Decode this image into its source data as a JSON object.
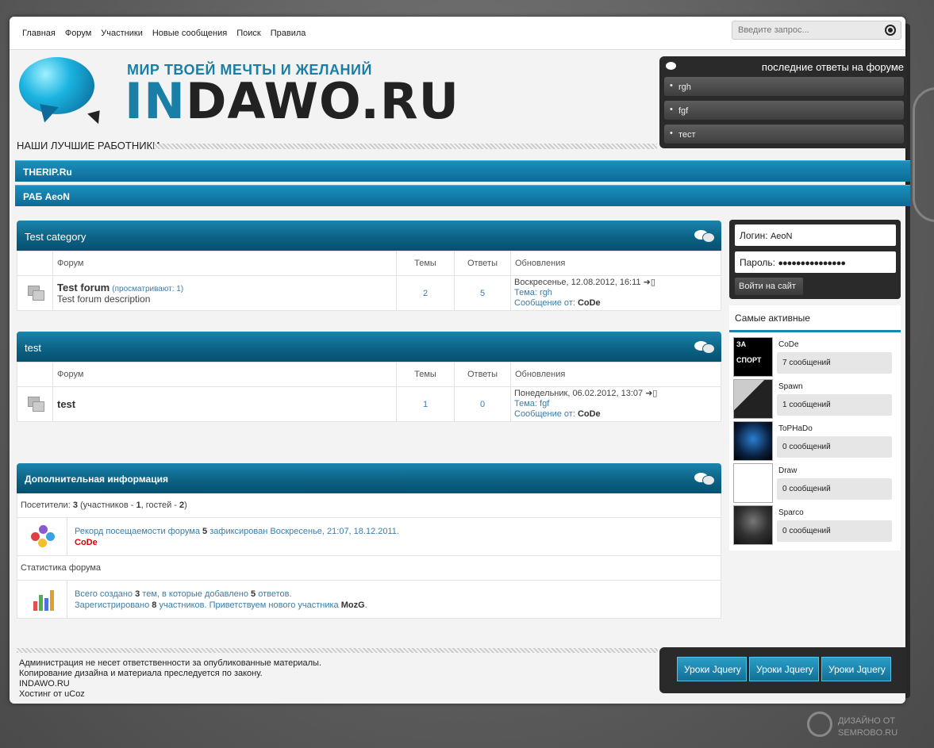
{
  "nav": {
    "items": [
      "Главная",
      "Форум",
      "Участники",
      "Новые сообщения",
      "Поиск",
      "Правила"
    ],
    "search_placeholder": "Введите запрос..."
  },
  "header": {
    "slogan": "МИР ТВОЕЙ МЕЧТЫ И ЖЕЛАНИЙ",
    "site_prefix": "IN",
    "site_rest": "DAWO.RU",
    "best_workers": "НАШИ ЛУЧШИЕ РАБОТНИКИ"
  },
  "latest": {
    "title": "последние ответы на форуме",
    "items": [
      "rgh",
      "fgf",
      "тест"
    ]
  },
  "bars": [
    "THERIP.Ru",
    "РАБ AeoN"
  ],
  "columns": {
    "forum": "Форум",
    "topics": "Темы",
    "replies": "Ответы",
    "updates": "Обновления"
  },
  "categories": [
    {
      "title": "Test category",
      "forum": {
        "name": "Test forum",
        "viewing": "(просматривают: 1)",
        "description": "Test forum description",
        "topics": "2",
        "replies": "5",
        "date": "Воскресенье, 12.08.2012, 16:11",
        "topic_label": "Тема:",
        "topic": "rgh",
        "author_label": "Сообщение от:",
        "author": "CoDe"
      }
    },
    {
      "title": "test",
      "forum": {
        "name": "test",
        "viewing": "",
        "description": "",
        "topics": "1",
        "replies": "0",
        "date": "Понедельник, 06.02.2012, 13:07",
        "topic_label": "Тема:",
        "topic": "fgf",
        "author_label": "Сообщение от:",
        "author": "CoDe"
      }
    }
  ],
  "info": {
    "title": "Дополнительная информация",
    "visitors_label": "Посетители:",
    "visitors": "3",
    "visitors_mid1": "(участников -",
    "members": "1",
    "visitors_mid2": ", гостей -",
    "guests": "2",
    "visitors_end": ")",
    "record_pre": "Рекорд посещаемости форума",
    "record_num": "5",
    "record_post": "зафиксирован Воскресенье, 21:07, 18.12.2011.",
    "record_user": "CoDe",
    "stats_title": "Статистика форума",
    "stats_l1_a": "Всего создано",
    "stats_topics": "3",
    "stats_l1_b": "тем, в которые добавлено",
    "stats_replies": "5",
    "stats_l1_c": "ответов.",
    "stats_l2_a": "Зарегистрировано",
    "stats_members": "8",
    "stats_l2_b": "участников. Приветствуем нового участника",
    "stats_newest": "MozG",
    "stats_l2_c": "."
  },
  "login": {
    "login_label": "Логин:",
    "login_value": "AeoN",
    "password_label": "Пароль:",
    "password_value": "●●●●●●●●●●●●●●●",
    "submit": "Войти на сайт"
  },
  "active": {
    "title": "Самые активные",
    "users": [
      {
        "name": "CoDe",
        "count": "7 сообщений"
      },
      {
        "name": "Spawn",
        "count": "1 сообщений"
      },
      {
        "name": "ToPHaDo",
        "count": "0 сообщений"
      },
      {
        "name": "Draw",
        "count": "0 сообщений"
      },
      {
        "name": "Sparco",
        "count": "0 сообщений"
      }
    ]
  },
  "footer": {
    "lines": [
      "Администрация не несет ответственности за опубликованные материалы.",
      "Копирование дизайна и материала преследуется по закону.",
      "INDAWO.RU",
      "Хостинг от uCoz"
    ],
    "buttons": [
      "Уроки Jquery",
      "Уроки Jquery",
      "Уроки Jquery"
    ]
  },
  "watermark": {
    "line1": "ДИЗАЙНО ОТ",
    "line2": "SEMROBO.RU"
  },
  "colors": {
    "accent": "#1b86b0",
    "dark": "#2a2a2a",
    "record_user": "#dd0000"
  }
}
